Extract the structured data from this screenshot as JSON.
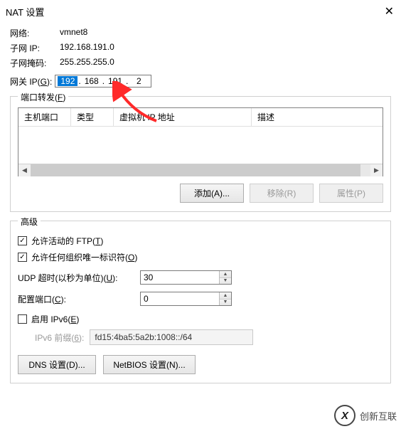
{
  "title": "NAT 设置",
  "network": {
    "label": "网络:",
    "value": "vmnet8"
  },
  "subnet_ip": {
    "label": "子网 IP:",
    "value": "192.168.191.0"
  },
  "subnet_mask": {
    "label": "子网掩码:",
    "value": "255.255.255.0"
  },
  "gateway": {
    "label_prefix": "网关 IP(",
    "hotkey": "G",
    "label_suffix": "):",
    "octets": [
      "192",
      "168",
      "191",
      "2"
    ]
  },
  "port_fwd": {
    "legend_prefix": "端口转发(",
    "hotkey": "F",
    "legend_suffix": ")",
    "columns": [
      "主机端口",
      "类型",
      "虚拟机 IP 地址",
      "描述"
    ]
  },
  "buttons": {
    "add": "添加(A)...",
    "remove": "移除(R)",
    "props": "属性(P)"
  },
  "advanced": {
    "legend": "高级",
    "allow_ftp_prefix": "允许活动的 FTP(",
    "allow_ftp_hotkey": "T",
    "allow_ftp_suffix": ")",
    "allow_oui_prefix": "允许任何组织唯一标识符(",
    "allow_oui_hotkey": "O",
    "allow_oui_suffix": ")",
    "udp_label_prefix": "UDP 超时(以秒为单位)(",
    "udp_hotkey": "U",
    "udp_label_suffix": "):",
    "udp_value": "30",
    "cfg_port_label_prefix": "配置端口(",
    "cfg_port_hotkey": "C",
    "cfg_port_label_suffix": "):",
    "cfg_port_value": "0",
    "ipv6_prefix_label": "启用 IPv6(",
    "ipv6_hotkey": "E",
    "ipv6_suffix": ")",
    "ipv6_prefix_field_label": "IPv6 前缀(",
    "ipv6_prefix_hotkey": "6",
    "ipv6_prefix_field_suffix": "):",
    "ipv6_prefix_value": "fd15:4ba5:5a2b:1008::/64",
    "dns_btn": "DNS 设置(D)...",
    "netbios_btn": "NetBIOS 设置(N)..."
  },
  "watermark": "创新互联"
}
